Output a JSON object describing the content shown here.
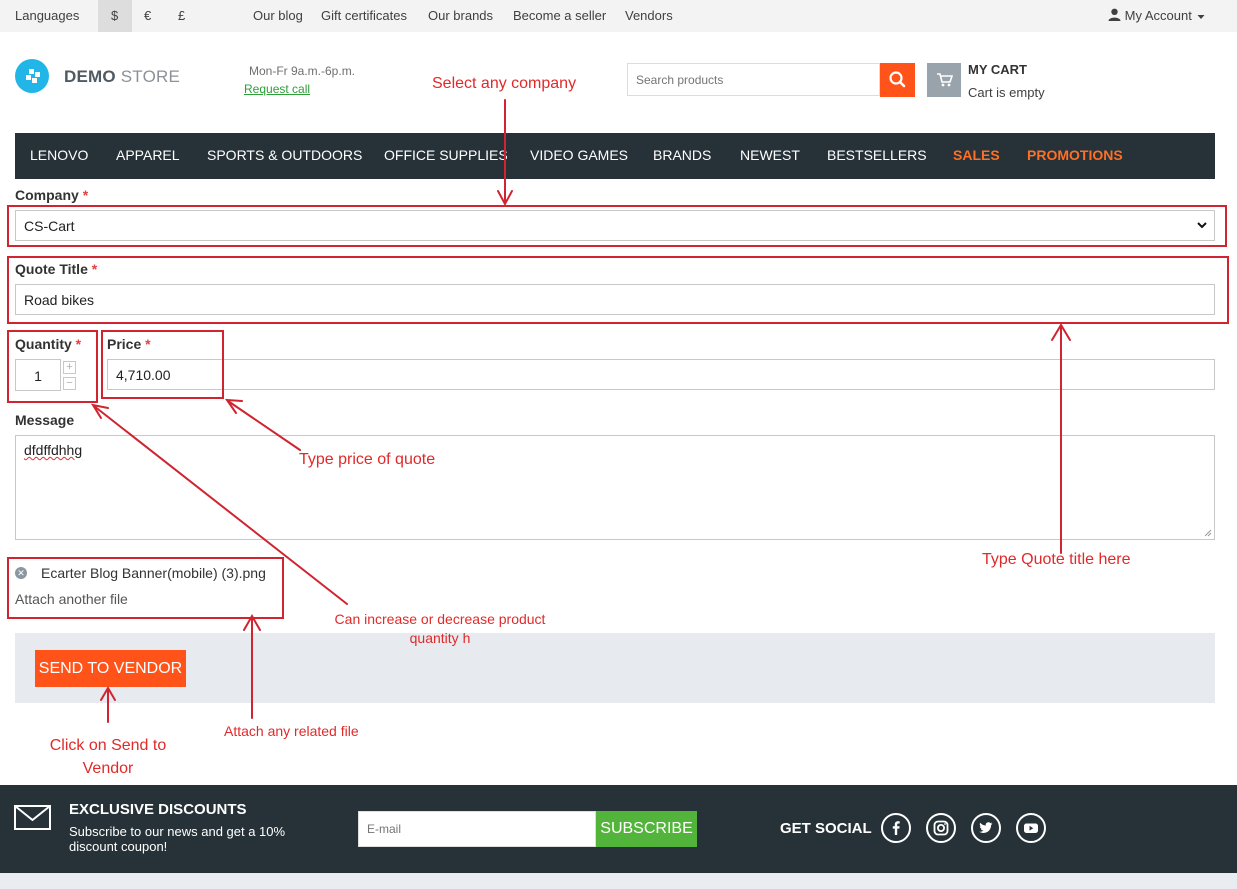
{
  "topbar": {
    "languages": "Languages",
    "currencies": [
      "$",
      "€",
      "£"
    ],
    "links": [
      "Our blog",
      "Gift certificates",
      "Our brands",
      "Become a seller",
      "Vendors"
    ],
    "account": "My Account"
  },
  "header": {
    "logo_bold": "DEMO",
    "logo_light": "STORE",
    "hours": "Mon-Fr 9a.m.-6p.m.",
    "request_call": "Request call",
    "search_placeholder": "Search products",
    "cart_title": "MY CART",
    "cart_status": "Cart is empty"
  },
  "nav": {
    "items": [
      "LENOVO",
      "APPAREL",
      "SPORTS & OUTDOORS",
      "OFFICE SUPPLIES",
      "VIDEO GAMES",
      "BRANDS",
      "NEWEST",
      "BESTSELLERS",
      "SALES",
      "PROMOTIONS"
    ]
  },
  "form": {
    "company_label": "Company",
    "company_value": "CS-Cart",
    "title_label": "Quote Title",
    "title_value": "Road bikes",
    "quantity_label": "Quantity",
    "quantity_value": "1",
    "price_label": "Price",
    "price_value": "4,710.00",
    "message_label": "Message",
    "message_value": "dfdffdhhg",
    "file_name": "Ecarter Blog Banner(mobile) (3).png",
    "attach_another": "Attach another file",
    "required_mark": "*",
    "send_button": "SEND TO VENDOR"
  },
  "annotations": {
    "select_company": "Select any company",
    "type_price": "Type price of quote",
    "type_title": "Type Quote title here",
    "quantity_note": "Can increase or decrease product quantity h",
    "attach_note": "Attach any related file",
    "send_note": "Click on Send to Vendor",
    "color": "#e02a2a"
  },
  "footer": {
    "title": "EXCLUSIVE DISCOUNTS",
    "subtitle": "Subscribe to our news and get a 10% discount coupon!",
    "email_placeholder": "E-mail",
    "subscribe": "SUBSCRIBE",
    "get_social": "GET SOCIAL",
    "social_icons": [
      "facebook-icon",
      "instagram-icon",
      "twitter-icon",
      "youtube-icon"
    ]
  },
  "colors": {
    "accent_orange": "#ff5319",
    "nav_bg": "#263238",
    "logo_blue": "#22b6e8",
    "subscribe_green": "#53b43b"
  }
}
